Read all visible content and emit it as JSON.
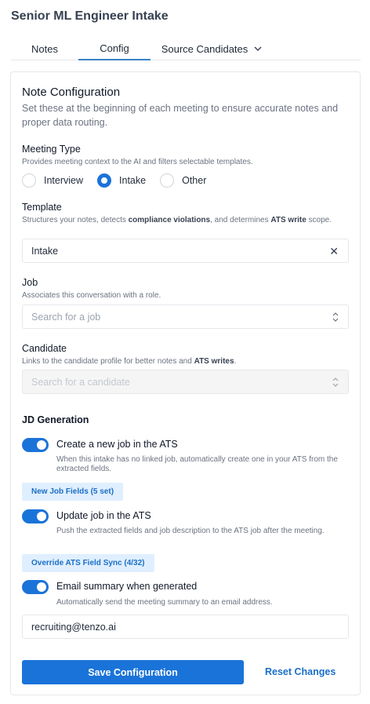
{
  "page_title": "Senior ML Engineer Intake",
  "tabs": [
    {
      "label": "Notes"
    },
    {
      "label": "Config"
    },
    {
      "label": "Source Candidates"
    }
  ],
  "section": {
    "title": "Note Configuration",
    "description": "Set these at the beginning of each meeting to ensure accurate notes and proper data routing."
  },
  "meeting_type": {
    "label": "Meeting Type",
    "help": "Provides meeting context to the AI and filters selectable templates.",
    "options": [
      "Interview",
      "Intake",
      "Other"
    ],
    "selected": "Intake"
  },
  "template": {
    "label": "Template",
    "help_parts": [
      "Structures your notes, detects ",
      "compliance violations",
      ", and determines ",
      "ATS write",
      " scope."
    ],
    "value": "Intake"
  },
  "job": {
    "label": "Job",
    "help": "Associates this conversation with a role.",
    "placeholder": "Search for a job"
  },
  "candidate": {
    "label": "Candidate",
    "help_parts": [
      "Links to the candidate profile for better notes and ",
      "ATS writes",
      "."
    ],
    "placeholder": "Search for a candidate"
  },
  "jd_generation": {
    "title": "JD Generation",
    "create_job": {
      "label": "Create a new job in the ATS",
      "help": "When this intake has no linked job, automatically create one in your ATS from the extracted fields.",
      "enabled": true,
      "chip": "New Job Fields (5 set)"
    },
    "update_job": {
      "label": "Update job in the ATS",
      "help": "Push the extracted fields and job description to the ATS job after the meeting.",
      "enabled": true,
      "chip": "Override ATS Field Sync (4/32)"
    },
    "email_summary": {
      "label": "Email summary when generated",
      "help": "Automatically send the meeting summary to an email address.",
      "enabled": true,
      "email": "recruiting@tenzo.ai"
    }
  },
  "actions": {
    "save": "Save Configuration",
    "reset": "Reset Changes"
  },
  "colors": {
    "accent": "#1a73d9",
    "chip_bg": "#e0efff"
  }
}
